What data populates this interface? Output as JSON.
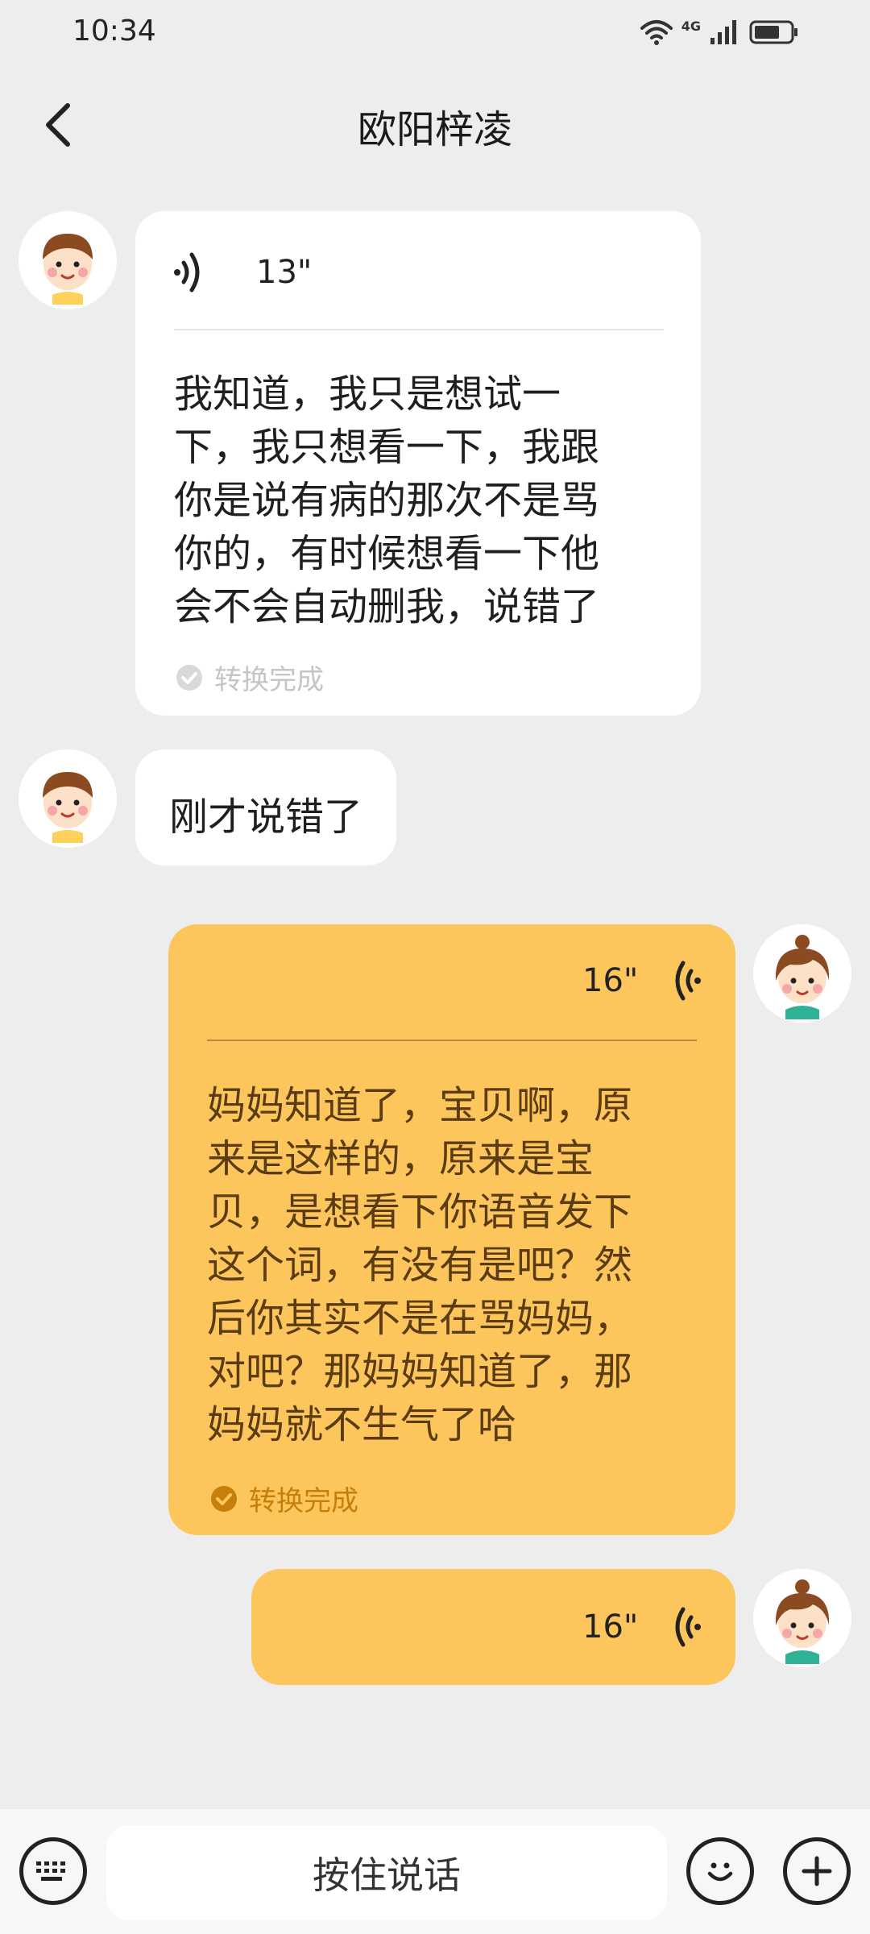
{
  "status_bar": {
    "time": "10:34",
    "network": "4G",
    "icons": [
      "wifi-icon",
      "signal-icon",
      "battery-icon"
    ]
  },
  "header": {
    "title": "欧阳梓凌",
    "back_icon": "chevron-left-icon"
  },
  "messages": [
    {
      "side": "left",
      "type": "voice",
      "duration": "13\"",
      "transcript_lines": [
        "我知道，我只是想试一",
        "下，我只想看一下，我跟",
        "你是说有病的那次不是骂",
        "你的，有时候想看一下他",
        "会不会自动删我，说错了"
      ],
      "status": "转换完成"
    },
    {
      "side": "left",
      "type": "text",
      "text": "刚才说错了"
    },
    {
      "side": "right",
      "type": "voice",
      "duration": "16\"",
      "transcript_lines": [
        "妈妈知道了，宝贝啊，原",
        "来是这样的，原来是宝",
        "贝，是想看下你语音发下",
        "这个词，有没有是吧？然",
        "后你其实不是在骂妈妈，",
        "对吧？那妈妈知道了，那",
        "妈妈就不生气了哈"
      ],
      "status": "转换完成"
    },
    {
      "side": "right",
      "type": "voice",
      "duration": "16\""
    }
  ],
  "input_bar": {
    "hold_to_talk_label": "按住说话",
    "left_icon": "keyboard-icon",
    "emoji_icon": "smiley-icon",
    "plus_icon": "plus-icon"
  },
  "colors": {
    "background": "#ededed",
    "bubble_self": "#fcc65c",
    "bubble_other": "#ffffff",
    "status_done_self": "#c57f0a",
    "status_done_other": "#c5c5c5"
  }
}
